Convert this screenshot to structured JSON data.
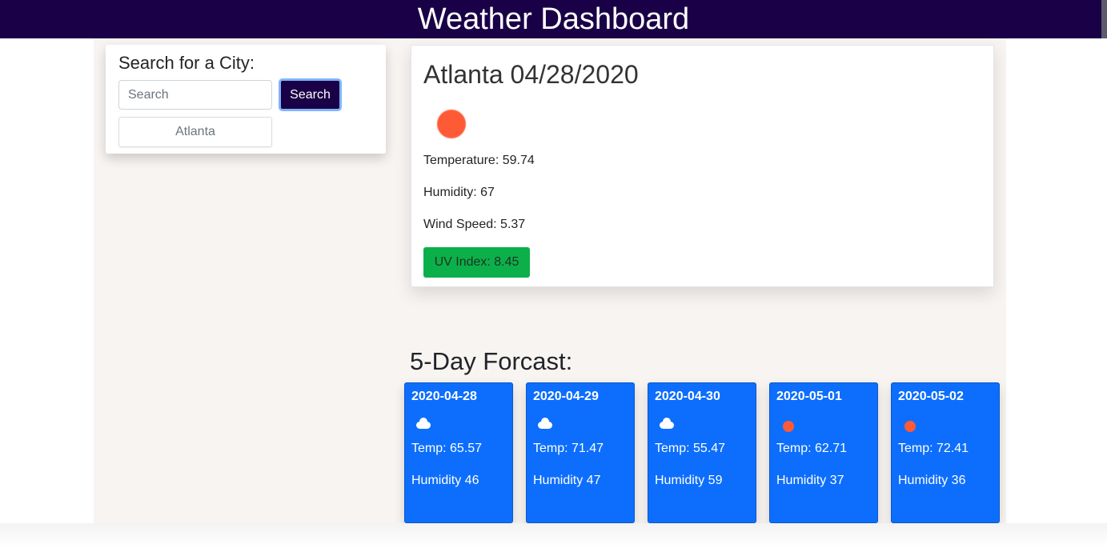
{
  "header": {
    "title": "Weather Dashboard"
  },
  "search": {
    "heading": "Search for a City:",
    "placeholder": "Search",
    "value": "",
    "button_label": "Search",
    "history": [
      "Atlanta"
    ]
  },
  "current": {
    "title": "Atlanta 04/28/2020",
    "icon": "sun-icon",
    "temperature": "Temperature: 59.74",
    "humidity": "Humidity: 67",
    "wind": "Wind Speed: 5.37",
    "uv": "UV Index: 8.45",
    "uv_color": "#0bb04a"
  },
  "forecast": {
    "heading": "5-Day Forcast:",
    "days": [
      {
        "date": "2020-04-28",
        "icon": "cloud-icon",
        "temp": "Temp: 65.57",
        "humidity": "Humidity 46"
      },
      {
        "date": "2020-04-29",
        "icon": "cloud-icon",
        "temp": "Temp: 71.47",
        "humidity": "Humidity 47"
      },
      {
        "date": "2020-04-30",
        "icon": "cloud-icon",
        "temp": "Temp: 55.47",
        "humidity": "Humidity 59"
      },
      {
        "date": "2020-05-01",
        "icon": "sun-icon",
        "temp": "Temp: 62.71",
        "humidity": "Humidity 37"
      },
      {
        "date": "2020-05-02",
        "icon": "sun-icon",
        "temp": "Temp: 72.41",
        "humidity": "Humidity 36"
      }
    ]
  },
  "colors": {
    "header_bg": "#1a0046",
    "card_blue": "#0d6efd",
    "sun": "#ff5a36"
  }
}
